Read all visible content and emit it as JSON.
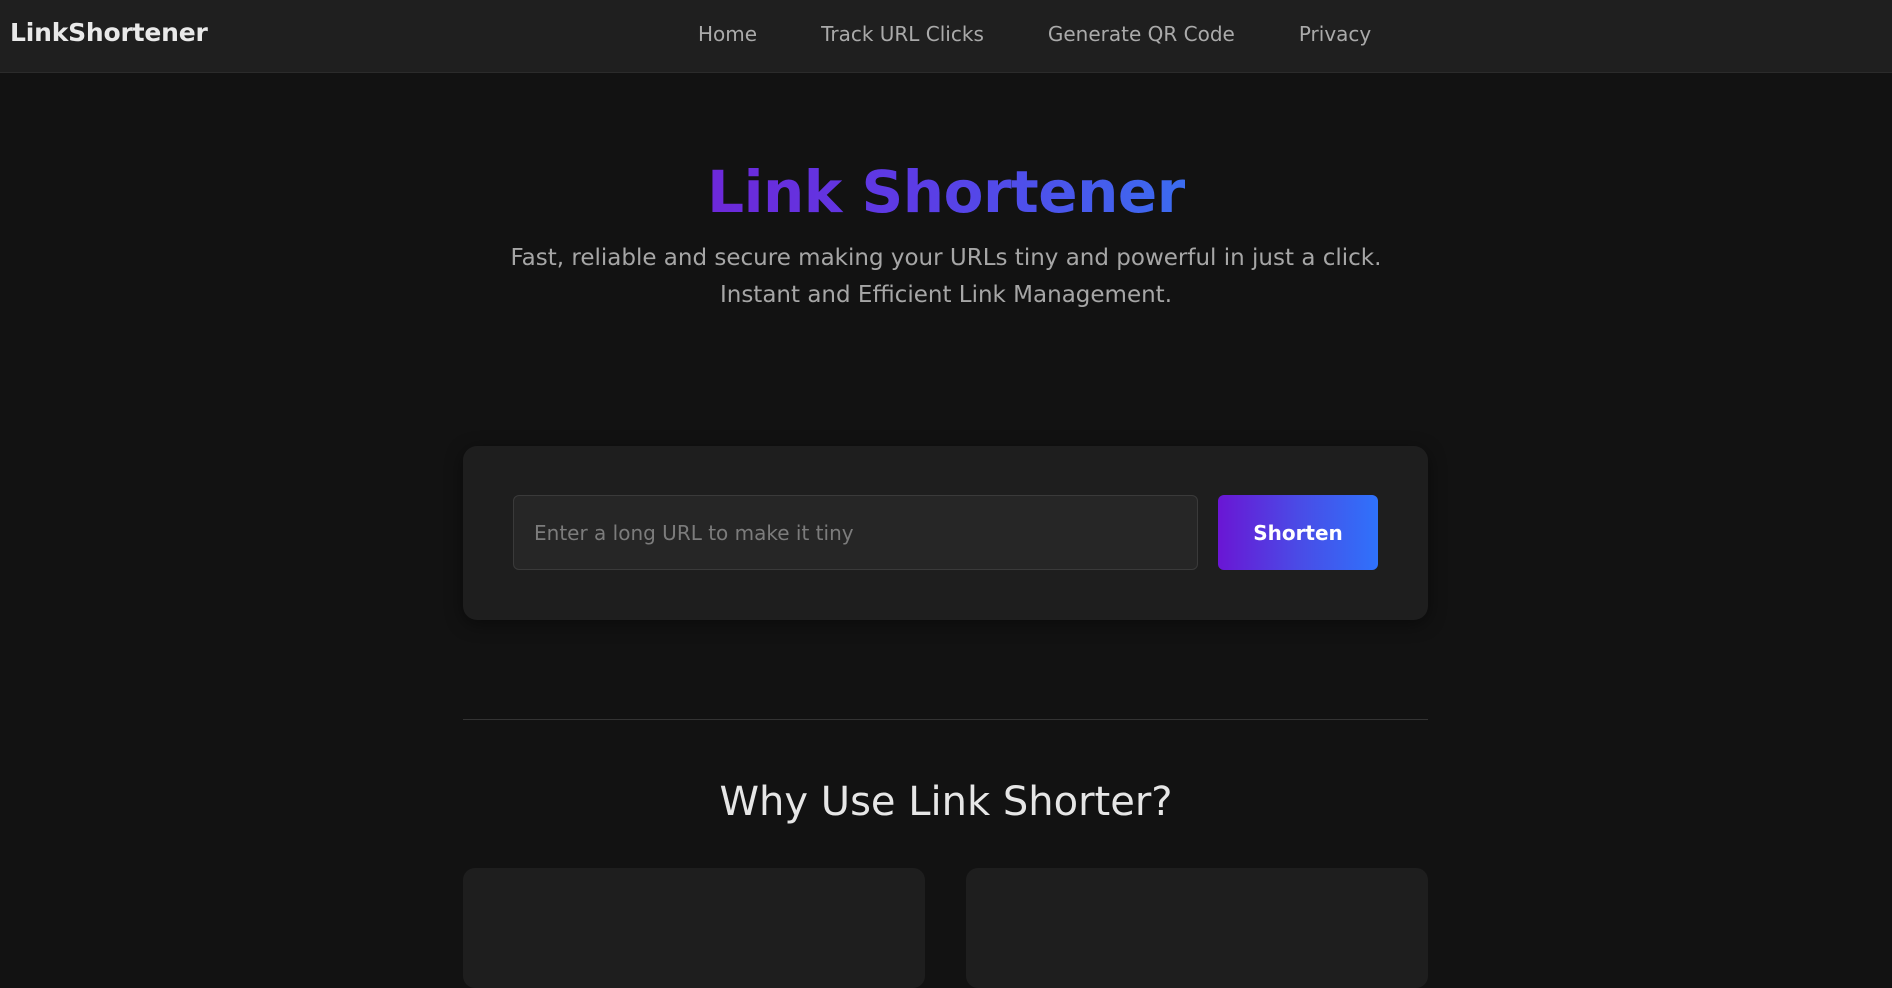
{
  "nav": {
    "brand": "LinkShortener",
    "links": [
      "Home",
      "Track URL Clicks",
      "Generate QR Code",
      "Privacy"
    ]
  },
  "hero": {
    "title": "Link Shortener",
    "subtitle_line1": "Fast, reliable and secure making your URLs tiny and powerful in just a click.",
    "subtitle_line2": "Instant and Efficient Link Management."
  },
  "shortener": {
    "placeholder": "Enter a long URL to make it tiny",
    "value": "",
    "button_label": "Shorten"
  },
  "features": {
    "title": "Why Use Link Shorter?"
  },
  "colors": {
    "background": "#121212",
    "navbar": "#1f1f1f",
    "card": "#1e1e1e",
    "accent_start": "#6a16d4",
    "accent_end": "#2f72fb"
  }
}
